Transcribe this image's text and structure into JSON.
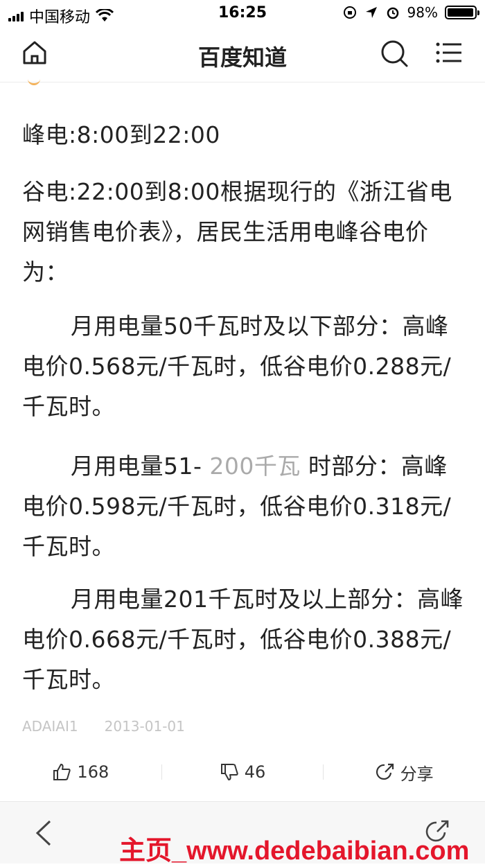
{
  "status_bar": {
    "carrier": "中国移动",
    "time": "16:25",
    "battery": "98%",
    "battery_level": 0.98
  },
  "nav": {
    "title": "百度知道",
    "home_icon": "home-icon",
    "search_icon": "search-icon",
    "menu_icon": "menu-icon"
  },
  "content": {
    "p1": "峰电:8:00到22:00",
    "p2": "谷电:22:00到8:00根据现行的《浙江省电网销售电价表》，居民生活用电峰谷电价为：",
    "p3": "月用电量50千瓦时及以下部分：高峰电价0.568元/千瓦时，低谷电价0.288元/千瓦时。",
    "p4_a": "月用电量51-",
    "p4_gray": "200千瓦",
    "p4_b": "时部分：高峰电价0.598元/千瓦时，低谷电价0.318元/千瓦时。",
    "p5": "月用电量201千瓦时及以上部分：高峰电价0.668元/千瓦时，低谷电价0.388元/千瓦时。"
  },
  "meta": {
    "author": "ADAIAI1",
    "date": "2013-01-01"
  },
  "actions": {
    "like_count": "168",
    "dislike_count": "46",
    "share_label": "分享"
  },
  "watermark": "主页_www.dedebaibian.com"
}
